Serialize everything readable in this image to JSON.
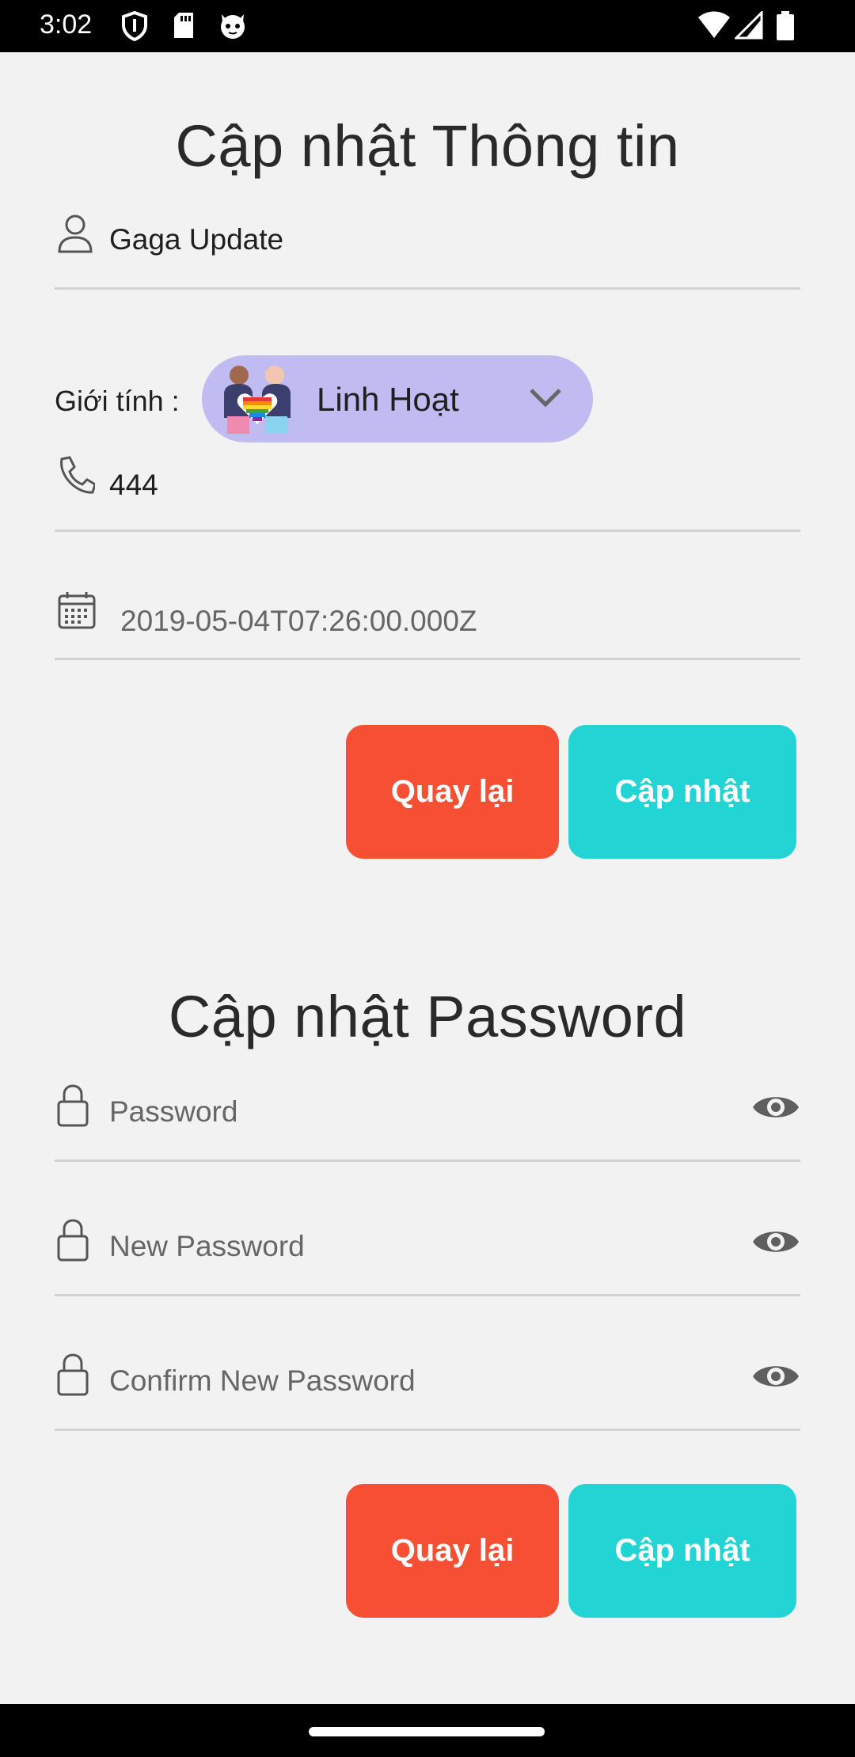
{
  "status_bar": {
    "time": "3:02",
    "icons_left": [
      "shield-icon",
      "sd-card-icon",
      "cat-icon"
    ],
    "icons_right": [
      "wifi-icon",
      "cell-signal-icon",
      "battery-icon"
    ]
  },
  "profile": {
    "title": "Cập nhật Thông tin",
    "name": {
      "icon": "person-icon",
      "value": "Gaga Update"
    },
    "gender": {
      "label": "Giới tính :",
      "icon": "lgbt-couple-icon",
      "value": "Linh Hoạt",
      "dropdown_icon": "chevron-down-icon",
      "bg_color": "#c0bcf2"
    },
    "phone": {
      "icon": "phone-icon",
      "value": "444"
    },
    "date": {
      "icon": "calendar-icon",
      "value": "2019-05-04T07:26:00.000Z"
    },
    "back_label": "Quay lại",
    "update_label": "Cập nhật"
  },
  "password": {
    "title": "Cập nhật Password",
    "fields": [
      {
        "icon": "lock-icon",
        "placeholder": "Password",
        "toggle_icon": "eye-icon"
      },
      {
        "icon": "lock-icon",
        "placeholder": "New Password",
        "toggle_icon": "eye-icon"
      },
      {
        "icon": "lock-icon",
        "placeholder": "Confirm New Password",
        "toggle_icon": "eye-icon"
      }
    ],
    "back_label": "Quay lại",
    "update_label": "Cập nhật"
  },
  "colors": {
    "back_button": "#f64f33",
    "update_button": "#23d4d4",
    "background": "#f2f2f2"
  }
}
